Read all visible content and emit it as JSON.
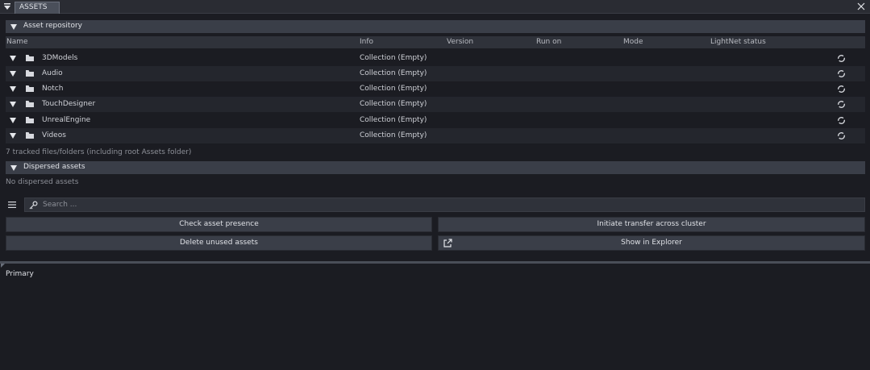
{
  "tab": {
    "label": "ASSETS"
  },
  "repository": {
    "header": "Asset repository",
    "columns": [
      "Name",
      "Info",
      "Version",
      "Run on",
      "Mode",
      "LightNet status"
    ],
    "rows": [
      {
        "name": "3DModels",
        "info": "Collection (Empty)"
      },
      {
        "name": "Audio",
        "info": "Collection (Empty)"
      },
      {
        "name": "Notch",
        "info": "Collection (Empty)"
      },
      {
        "name": "TouchDesigner",
        "info": "Collection (Empty)"
      },
      {
        "name": "UnrealEngine",
        "info": "Collection (Empty)"
      },
      {
        "name": "Videos",
        "info": "Collection (Empty)"
      }
    ],
    "tracked_note": "7 tracked files/folders (including root Assets folder)"
  },
  "dispersed": {
    "header": "Dispersed assets",
    "note": "No dispersed assets"
  },
  "search": {
    "placeholder": "Search ..."
  },
  "buttons": {
    "check_presence": "Check asset presence",
    "initiate_transfer": "Initiate transfer across cluster",
    "delete_unused": "Delete unused assets",
    "show_explorer": "Show in Explorer"
  },
  "primary": {
    "label": "Primary"
  }
}
